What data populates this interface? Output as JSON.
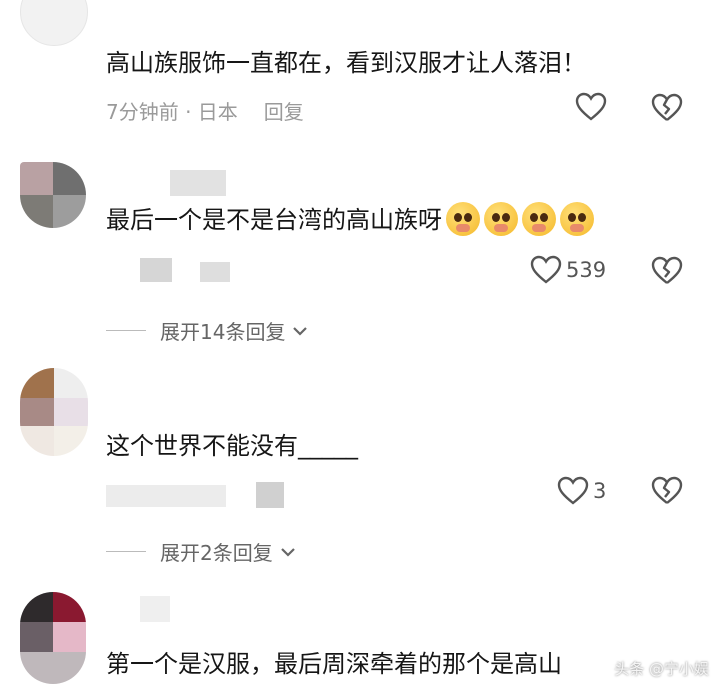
{
  "comments": [
    {
      "text": "高山族服饰一直都在，看到汉服才让人落泪！",
      "meta_time": "7分钟前 · 日本",
      "reply_label": "回复",
      "like_count": ""
    },
    {
      "text": "最后一个是不是台湾的高山族呀",
      "like_count": "539",
      "expand_label": "展开14条回复"
    },
    {
      "text": "这个世界不能没有_____",
      "like_count": "3",
      "expand_label": "展开2条回复"
    },
    {
      "text": "第一个是汉服，最后周深牵着的那个是高山"
    }
  ],
  "watermark": "头条 @宁小娱",
  "colors": {
    "meta": "#9a9a9a",
    "emoji": "#f5b829"
  }
}
